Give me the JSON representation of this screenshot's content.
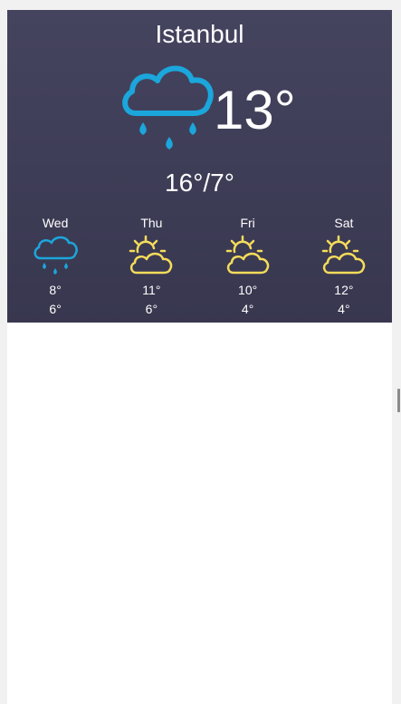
{
  "city": "Istanbul",
  "current": {
    "temperature": "13°",
    "range": "16°/7°",
    "icon": "rain-cloud-icon"
  },
  "forecast": [
    {
      "day": "Wed",
      "high": "8°",
      "low": "6°",
      "icon": "rain-cloud-icon"
    },
    {
      "day": "Thu",
      "high": "11°",
      "low": "6°",
      "icon": "partly-sunny-icon"
    },
    {
      "day": "Fri",
      "high": "10°",
      "low": "4°",
      "icon": "partly-sunny-icon"
    },
    {
      "day": "Sat",
      "high": "12°",
      "low": "4°",
      "icon": "partly-sunny-icon"
    }
  ],
  "colors": {
    "widget_background": "#403f59",
    "rain_icon": "#1ba6dc",
    "sun_icon": "#f5dc5a",
    "text": "#ffffff"
  }
}
